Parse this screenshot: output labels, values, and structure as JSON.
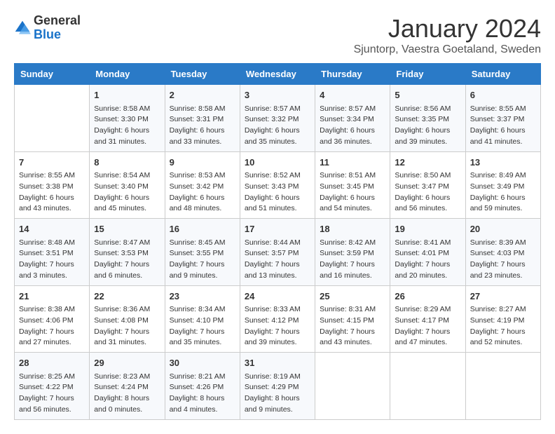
{
  "logo": {
    "general": "General",
    "blue": "Blue"
  },
  "title": "January 2024",
  "subtitle": "Sjuntorp, Vaestra Goetaland, Sweden",
  "headers": [
    "Sunday",
    "Monday",
    "Tuesday",
    "Wednesday",
    "Thursday",
    "Friday",
    "Saturday"
  ],
  "weeks": [
    [
      {
        "day": "",
        "sunrise": "",
        "sunset": "",
        "daylight": ""
      },
      {
        "day": "1",
        "sunrise": "Sunrise: 8:58 AM",
        "sunset": "Sunset: 3:30 PM",
        "daylight": "Daylight: 6 hours and 31 minutes."
      },
      {
        "day": "2",
        "sunrise": "Sunrise: 8:58 AM",
        "sunset": "Sunset: 3:31 PM",
        "daylight": "Daylight: 6 hours and 33 minutes."
      },
      {
        "day": "3",
        "sunrise": "Sunrise: 8:57 AM",
        "sunset": "Sunset: 3:32 PM",
        "daylight": "Daylight: 6 hours and 35 minutes."
      },
      {
        "day": "4",
        "sunrise": "Sunrise: 8:57 AM",
        "sunset": "Sunset: 3:34 PM",
        "daylight": "Daylight: 6 hours and 36 minutes."
      },
      {
        "day": "5",
        "sunrise": "Sunrise: 8:56 AM",
        "sunset": "Sunset: 3:35 PM",
        "daylight": "Daylight: 6 hours and 39 minutes."
      },
      {
        "day": "6",
        "sunrise": "Sunrise: 8:55 AM",
        "sunset": "Sunset: 3:37 PM",
        "daylight": "Daylight: 6 hours and 41 minutes."
      }
    ],
    [
      {
        "day": "7",
        "sunrise": "Sunrise: 8:55 AM",
        "sunset": "Sunset: 3:38 PM",
        "daylight": "Daylight: 6 hours and 43 minutes."
      },
      {
        "day": "8",
        "sunrise": "Sunrise: 8:54 AM",
        "sunset": "Sunset: 3:40 PM",
        "daylight": "Daylight: 6 hours and 45 minutes."
      },
      {
        "day": "9",
        "sunrise": "Sunrise: 8:53 AM",
        "sunset": "Sunset: 3:42 PM",
        "daylight": "Daylight: 6 hours and 48 minutes."
      },
      {
        "day": "10",
        "sunrise": "Sunrise: 8:52 AM",
        "sunset": "Sunset: 3:43 PM",
        "daylight": "Daylight: 6 hours and 51 minutes."
      },
      {
        "day": "11",
        "sunrise": "Sunrise: 8:51 AM",
        "sunset": "Sunset: 3:45 PM",
        "daylight": "Daylight: 6 hours and 54 minutes."
      },
      {
        "day": "12",
        "sunrise": "Sunrise: 8:50 AM",
        "sunset": "Sunset: 3:47 PM",
        "daylight": "Daylight: 6 hours and 56 minutes."
      },
      {
        "day": "13",
        "sunrise": "Sunrise: 8:49 AM",
        "sunset": "Sunset: 3:49 PM",
        "daylight": "Daylight: 6 hours and 59 minutes."
      }
    ],
    [
      {
        "day": "14",
        "sunrise": "Sunrise: 8:48 AM",
        "sunset": "Sunset: 3:51 PM",
        "daylight": "Daylight: 7 hours and 3 minutes."
      },
      {
        "day": "15",
        "sunrise": "Sunrise: 8:47 AM",
        "sunset": "Sunset: 3:53 PM",
        "daylight": "Daylight: 7 hours and 6 minutes."
      },
      {
        "day": "16",
        "sunrise": "Sunrise: 8:45 AM",
        "sunset": "Sunset: 3:55 PM",
        "daylight": "Daylight: 7 hours and 9 minutes."
      },
      {
        "day": "17",
        "sunrise": "Sunrise: 8:44 AM",
        "sunset": "Sunset: 3:57 PM",
        "daylight": "Daylight: 7 hours and 13 minutes."
      },
      {
        "day": "18",
        "sunrise": "Sunrise: 8:42 AM",
        "sunset": "Sunset: 3:59 PM",
        "daylight": "Daylight: 7 hours and 16 minutes."
      },
      {
        "day": "19",
        "sunrise": "Sunrise: 8:41 AM",
        "sunset": "Sunset: 4:01 PM",
        "daylight": "Daylight: 7 hours and 20 minutes."
      },
      {
        "day": "20",
        "sunrise": "Sunrise: 8:39 AM",
        "sunset": "Sunset: 4:03 PM",
        "daylight": "Daylight: 7 hours and 23 minutes."
      }
    ],
    [
      {
        "day": "21",
        "sunrise": "Sunrise: 8:38 AM",
        "sunset": "Sunset: 4:06 PM",
        "daylight": "Daylight: 7 hours and 27 minutes."
      },
      {
        "day": "22",
        "sunrise": "Sunrise: 8:36 AM",
        "sunset": "Sunset: 4:08 PM",
        "daylight": "Daylight: 7 hours and 31 minutes."
      },
      {
        "day": "23",
        "sunrise": "Sunrise: 8:34 AM",
        "sunset": "Sunset: 4:10 PM",
        "daylight": "Daylight: 7 hours and 35 minutes."
      },
      {
        "day": "24",
        "sunrise": "Sunrise: 8:33 AM",
        "sunset": "Sunset: 4:12 PM",
        "daylight": "Daylight: 7 hours and 39 minutes."
      },
      {
        "day": "25",
        "sunrise": "Sunrise: 8:31 AM",
        "sunset": "Sunset: 4:15 PM",
        "daylight": "Daylight: 7 hours and 43 minutes."
      },
      {
        "day": "26",
        "sunrise": "Sunrise: 8:29 AM",
        "sunset": "Sunset: 4:17 PM",
        "daylight": "Daylight: 7 hours and 47 minutes."
      },
      {
        "day": "27",
        "sunrise": "Sunrise: 8:27 AM",
        "sunset": "Sunset: 4:19 PM",
        "daylight": "Daylight: 7 hours and 52 minutes."
      }
    ],
    [
      {
        "day": "28",
        "sunrise": "Sunrise: 8:25 AM",
        "sunset": "Sunset: 4:22 PM",
        "daylight": "Daylight: 7 hours and 56 minutes."
      },
      {
        "day": "29",
        "sunrise": "Sunrise: 8:23 AM",
        "sunset": "Sunset: 4:24 PM",
        "daylight": "Daylight: 8 hours and 0 minutes."
      },
      {
        "day": "30",
        "sunrise": "Sunrise: 8:21 AM",
        "sunset": "Sunset: 4:26 PM",
        "daylight": "Daylight: 8 hours and 4 minutes."
      },
      {
        "day": "31",
        "sunrise": "Sunrise: 8:19 AM",
        "sunset": "Sunset: 4:29 PM",
        "daylight": "Daylight: 8 hours and 9 minutes."
      },
      {
        "day": "",
        "sunrise": "",
        "sunset": "",
        "daylight": ""
      },
      {
        "day": "",
        "sunrise": "",
        "sunset": "",
        "daylight": ""
      },
      {
        "day": "",
        "sunrise": "",
        "sunset": "",
        "daylight": ""
      }
    ]
  ]
}
